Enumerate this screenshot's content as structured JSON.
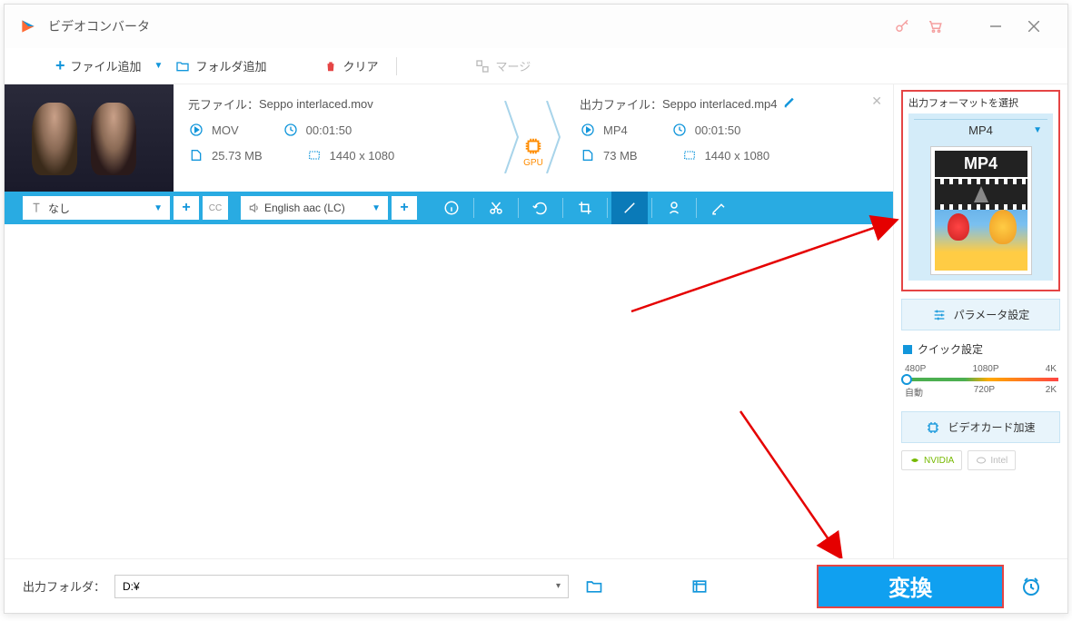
{
  "title": "ビデオコンバータ",
  "toolbar": {
    "add_file": "ファイル追加",
    "add_folder": "フォルダ追加",
    "clear": "クリア",
    "merge": "マージ"
  },
  "file": {
    "source_label": "元ファイル：",
    "source_name": "Seppo interlaced.mov",
    "output_label": "出力ファイル：",
    "output_name": "Seppo interlaced.mp4",
    "src_format": "MOV",
    "src_duration": "00:01:50",
    "src_size": "25.73 MB",
    "src_resolution": "1440 x 1080",
    "out_format": "MP4",
    "out_duration": "00:01:50",
    "out_size": "73 MB",
    "out_resolution": "1440 x 1080",
    "gpu_label": "GPU"
  },
  "actionbar": {
    "subtitle_value": "なし",
    "audio_value": "English aac (LC)"
  },
  "sidebar": {
    "format_title": "出力フォーマットを選択",
    "format_selected": "MP4",
    "format_thumb_label": "MP4",
    "param_settings": "パラメータ設定",
    "quick_settings": "クイック設定",
    "quality": {
      "top": [
        "480P",
        "1080P",
        "4K"
      ],
      "bottom": [
        "自動",
        "720P",
        "2K"
      ]
    },
    "gpu_accel": "ビデオカード加速",
    "nvidia": "NVIDIA",
    "intel": "Intel"
  },
  "footer": {
    "output_folder_label": "出力フォルダ：",
    "output_path": "D:¥",
    "convert": "変換"
  }
}
